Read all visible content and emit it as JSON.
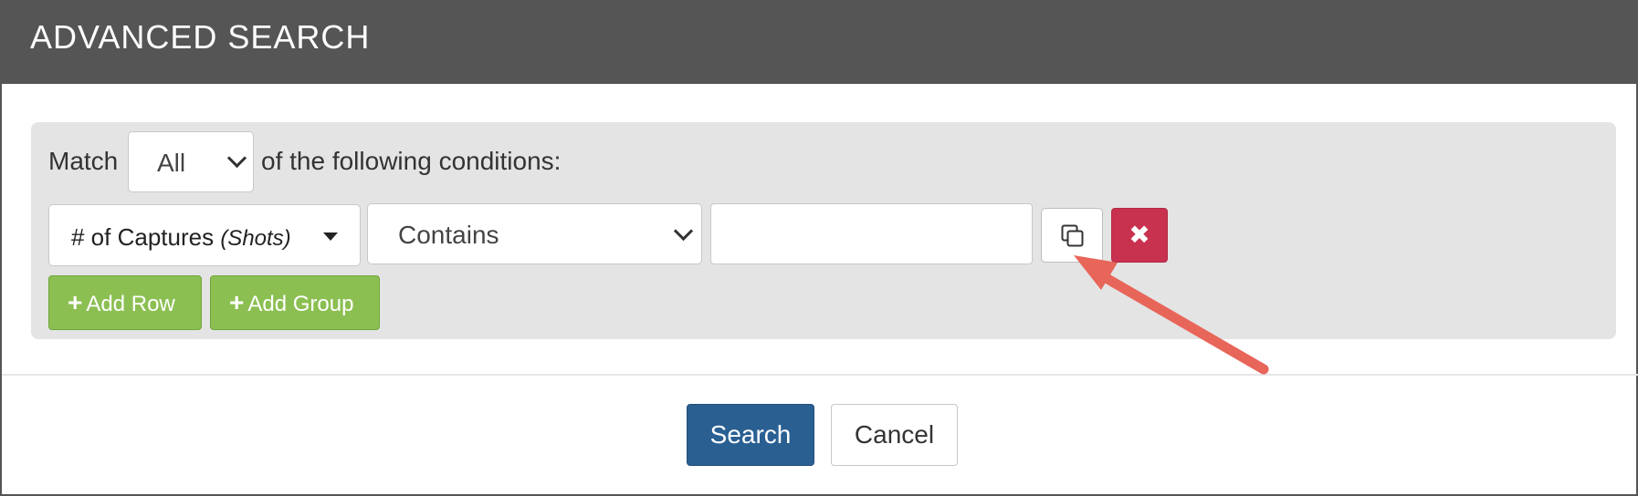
{
  "modal": {
    "title": "ADVANCED SEARCH"
  },
  "conditions": {
    "match_label": "Match",
    "match_value": "All",
    "suffix_label": "of the following conditions:",
    "row": {
      "field_main": "# of Captures ",
      "field_hint": "(Shots)",
      "operator": "Contains",
      "value": ""
    },
    "remove_label": "✖",
    "add_row_label": "Add Row",
    "add_group_label": "Add Group",
    "plus_glyph": "+"
  },
  "footer": {
    "search_label": "Search",
    "cancel_label": "Cancel"
  },
  "icons": {
    "copy": "copy-icon",
    "remove": "close-icon",
    "annotation": "arrow-annotation"
  },
  "colors": {
    "header_bg": "#555555",
    "remove_bg": "#c9324f",
    "add_bg": "#8cbf52",
    "search_bg": "#2a5f92",
    "arrow": "#e8655a"
  }
}
